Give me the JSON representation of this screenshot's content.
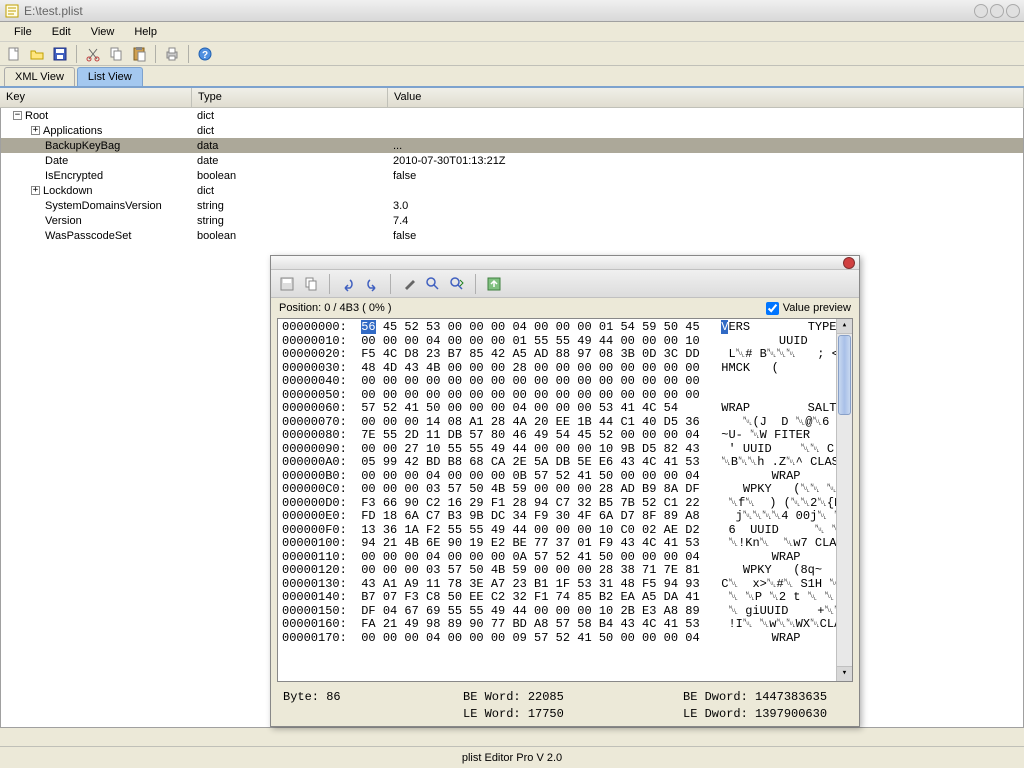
{
  "window": {
    "title": "E:\\test.plist"
  },
  "menus": {
    "file": "File",
    "edit": "Edit",
    "view": "View",
    "help": "Help"
  },
  "tabs": {
    "xml": "XML View",
    "list": "List View"
  },
  "columns": {
    "key": "Key",
    "type": "Type",
    "value": "Value"
  },
  "tree": [
    {
      "indent": 0,
      "expand": "-",
      "key": "Root",
      "type": "dict",
      "value": "",
      "selected": false
    },
    {
      "indent": 1,
      "expand": "+",
      "key": "Applications",
      "type": "dict",
      "value": "",
      "selected": false
    },
    {
      "indent": 1,
      "expand": "",
      "key": "BackupKeyBag",
      "type": "data",
      "value": "...",
      "selected": true
    },
    {
      "indent": 1,
      "expand": "",
      "key": "Date",
      "type": "date",
      "value": "2010-07-30T01:13:21Z",
      "selected": false
    },
    {
      "indent": 1,
      "expand": "",
      "key": "IsEncrypted",
      "type": "boolean",
      "value": "false",
      "selected": false
    },
    {
      "indent": 1,
      "expand": "+",
      "key": "Lockdown",
      "type": "dict",
      "value": "",
      "selected": false
    },
    {
      "indent": 1,
      "expand": "",
      "key": "SystemDomainsVersion",
      "type": "string",
      "value": "3.0",
      "selected": false
    },
    {
      "indent": 1,
      "expand": "",
      "key": "Version",
      "type": "string",
      "value": "7.4",
      "selected": false
    },
    {
      "indent": 1,
      "expand": "",
      "key": "WasPasscodeSet",
      "type": "boolean",
      "value": "false",
      "selected": false
    }
  ],
  "hex": {
    "position": "Position: 0 / 4B3 ( 0% )",
    "preview_label": "Value preview",
    "lines": [
      {
        "addr": "00000000:",
        "prefix": "",
        "sel": "56",
        "rest": " 45 52 53 00 00 00 04 00 00 00 01 54 59 50 45",
        "ascii_prefix": "",
        "ascii_sel": "V",
        "ascii_rest": "ERS        TYPE"
      },
      {
        "addr": "00000010:",
        "prefix": "00 00 00 04 00 00 00 01 55 55 49 44 00 00 00 10",
        "ascii": "        UUID"
      },
      {
        "addr": "00000020:",
        "prefix": "F5 4C D8 23 B7 85 42 A5 AD 88 97 08 3B 0D 3C DD",
        "ascii": " L␀# B␀␀␀   ; <"
      },
      {
        "addr": "00000030:",
        "prefix": "48 4D 43 4B 00 00 00 28 00 00 00 00 00 00 00 00",
        "ascii": "HMCK   ("
      },
      {
        "addr": "00000040:",
        "prefix": "00 00 00 00 00 00 00 00 00 00 00 00 00 00 00 00",
        "ascii": ""
      },
      {
        "addr": "00000050:",
        "prefix": "00 00 00 00 00 00 00 00 00 00 00 00 00 00 00 00",
        "ascii": ""
      },
      {
        "addr": "00000060:",
        "prefix": "57 52 41 50 00 00 00 04 00 00 00 53 41 4C 54",
        "ascii": "WRAP        SALT"
      },
      {
        "addr": "00000070:",
        "prefix": "00 00 00 14 08 A1 28 4A 20 EE 1B 44 C1 40 D5 36",
        "ascii": "   ␀(J  D ␀@␀6"
      },
      {
        "addr": "00000080:",
        "prefix": "7E 55 2D 11 DB 57 80 46 49 54 45 52 00 00 00 04",
        "ascii": "~U- ␀W FITER"
      },
      {
        "addr": "00000090:",
        "prefix": "00 00 27 10 55 55 49 44 00 00 00 10 9B D5 82 43",
        "ascii": " ' UUID    ␀␀ C"
      },
      {
        "addr": "000000A0:",
        "prefix": "05 99 42 BD B8 68 CA 2E 5A DB 5E E6 43 4C 41 53",
        "ascii": "␀B␀␀h .Z␀^ CLAS"
      },
      {
        "addr": "000000B0:",
        "prefix": "00 00 00 04 00 00 00 0B 57 52 41 50 00 00 00 04",
        "ascii": "       WRAP"
      },
      {
        "addr": "000000C0:",
        "prefix": "00 00 00 03 57 50 4B 59 00 00 00 28 AD B9 8A DF",
        "ascii": "   WPKY   (␀␀ ␀"
      },
      {
        "addr": "000000D0:",
        "prefix": "F3 66 90 C2 16 29 F1 28 94 C7 32 B5 7B 52 C1 22",
        "ascii": " ␀f␀  ) (␀␀2␀{R␀\""
      },
      {
        "addr": "000000E0:",
        "prefix": "FD 18 6A C7 B3 9B DC 34 F9 30 4F 6A D7 8F 89 A8",
        "ascii": "  j␀␀␀␀4 00j␀ ␀␀"
      },
      {
        "addr": "000000F0:",
        "prefix": "13 36 1A F2 55 55 49 44 00 00 00 10 C0 02 AE D2",
        "ascii": " 6  UUID     ␀ ␀␀"
      },
      {
        "addr": "00000100:",
        "prefix": "94 21 4B 6E 90 19 E2 BE 77 37 01 F9 43 4C 41 53",
        "ascii": " ␀!Kn␀  ␀w7 CLAS"
      },
      {
        "addr": "00000110:",
        "prefix": "00 00 00 04 00 00 00 0A 57 52 41 50 00 00 00 04",
        "ascii": "       WRAP"
      },
      {
        "addr": "00000120:",
        "prefix": "00 00 00 03 57 50 4B 59 00 00 00 28 38 71 7E 81",
        "ascii": "   WPKY   (8q~"
      },
      {
        "addr": "00000130:",
        "prefix": "43 A1 A9 11 78 3E A7 23 B1 1F 53 31 48 F5 94 93",
        "ascii": "C␀  x>␀#␀ S1H ␀␀"
      },
      {
        "addr": "00000140:",
        "prefix": "B7 07 F3 C8 50 EE C2 32 F1 74 85 B2 EA A5 DA 41",
        "ascii": " ␀ ␀P ␀2 t ␀ ␀ A"
      },
      {
        "addr": "00000150:",
        "prefix": "DF 04 67 69 55 55 49 44 00 00 00 10 2B E3 A8 89",
        "ascii": " ␀ giUUID    +␀␀"
      },
      {
        "addr": "00000160:",
        "prefix": "FA 21 49 98 89 90 77 BD A8 57 58 B4 43 4C 41 53",
        "ascii": " !I␀ ␀w␀␀WX␀CLAS"
      },
      {
        "addr": "00000170:",
        "prefix": "00 00 00 04 00 00 00 09 57 52 41 50 00 00 00 04",
        "ascii": "       WRAP"
      }
    ],
    "footer": {
      "byte_label": "Byte:",
      "byte_val": "86",
      "beword_label": "BE Word:",
      "beword_val": "22085",
      "bedword_label": "BE Dword:",
      "bedword_val": "1447383635",
      "leword_label": "LE Word:",
      "leword_val": "17750",
      "ledword_label": "LE Dword:",
      "ledword_val": "1397900630"
    }
  },
  "statusbar": "plist Editor Pro V 2.0"
}
